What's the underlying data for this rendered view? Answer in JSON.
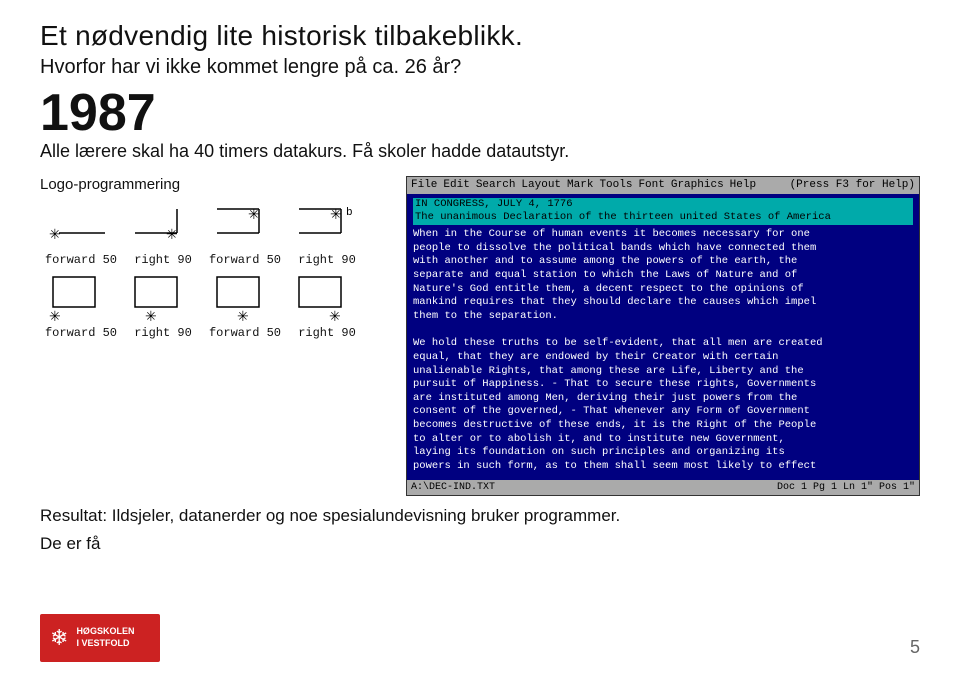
{
  "title": "Et nødvendig lite historisk tilbakeblikk.",
  "subtitle": "Hvorfor har vi ikke kommet lengre på ca. 26 år?",
  "year": "1987",
  "year_detail": "Alle lærere skal ha 40 timers datakurs. Få skoler hadde datautstyr.",
  "logo_label": "Logo-programmering",
  "diagrams": {
    "row1_labels": [
      "forward 50",
      "right 90",
      "forward 50",
      "right 90"
    ],
    "row2_labels": [
      "forward 50",
      "right 90",
      "forward 50",
      "right 90"
    ]
  },
  "wp": {
    "menubar_items": [
      "File",
      "Edit",
      "Search",
      "Layout",
      "Mark",
      "Tools",
      "Font",
      "Graphics",
      "Help"
    ],
    "menubar_help": "(Press F3 for Help)",
    "highlight_text": "IN CONGRESS, JULY 4, 1776",
    "highlight2": "The unanimous Declaration of the thirteen united States of America",
    "body_text": "When in the Course of human events it becomes necessary for one people to dissolve the political bands which have connected them with another and to assume among the powers of the earth, the separate and equal station to which the Laws of Nature and of Nature's God entitle them, a decent respect to the opinions of mankind requires that they should declare the causes which impel them to the separation.\n\nWe hold these truths to be self-evident, that all men are created equal, that they are endowed by their Creator with certain unalienable Rights, that among these are Life, Liberty and the pursuit of Happiness. - That to secure these rights, Governments are instituted among Men, deriving their just powers from the consent of the governed, - That whenever any Form of Government becomes destructive of these ends, it is the Right of the People to alter or to abolish it, and to institute new Government, laying its foundation on such principles and organizing its powers in such form, as to them shall seem most likely to effect",
    "statusbar_left": "A:\\DEC-IND.TXT",
    "statusbar_right": "Doc 1 Pg 1 Ln 1\" Pos 1\""
  },
  "result_text": "Resultat: Ildsjeler, datanerder og noe spesialundevisning bruker programmer.",
  "result_text2": "De er  få",
  "logo_institution": "HØGSKOLEN\nI VESTFOLD",
  "page_number": "5"
}
